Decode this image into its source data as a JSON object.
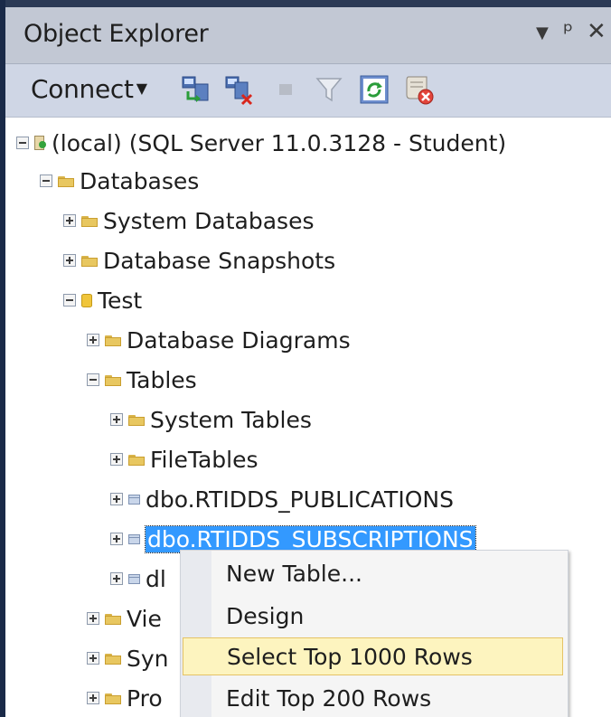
{
  "panel": {
    "title": "Object Explorer",
    "dropdown_icon": "dropdown-arrow",
    "pin_icon": "pin-icon",
    "close_icon": "close-icon"
  },
  "toolbar": {
    "connect_label": "Connect",
    "icons": [
      "connect-object-explorer-icon",
      "disconnect-icon",
      "stop-icon",
      "filter-icon",
      "refresh-icon",
      "summary-icon"
    ]
  },
  "tree": {
    "server": "(local) (SQL Server 11.0.3128 - Student)",
    "databases": "Databases",
    "system_databases": "System Databases",
    "database_snapshots": "Database Snapshots",
    "test_db": "Test",
    "database_diagrams": "Database Diagrams",
    "tables": "Tables",
    "system_tables": "System Tables",
    "filetables": "FileTables",
    "table_publications": "dbo.RTIDDS_PUBLICATIONS",
    "table_subscriptions": "dbo.RTIDDS_SUBSCRIPTIONS",
    "partial_table": "dl",
    "partial_views": "Vie",
    "partial_synonyms": "Syn",
    "partial_programmability": "Pro"
  },
  "context_menu": {
    "items": [
      "New Table...",
      "Design",
      "Select Top 1000 Rows",
      "Edit Top 200 Rows"
    ],
    "highlighted": "Select Top 1000 Rows"
  },
  "colors": {
    "selection": "#3399ff",
    "menu_highlight": "#fdf4bf",
    "title_bar": "#c2c8d4",
    "toolbar": "#cfd6e5"
  }
}
